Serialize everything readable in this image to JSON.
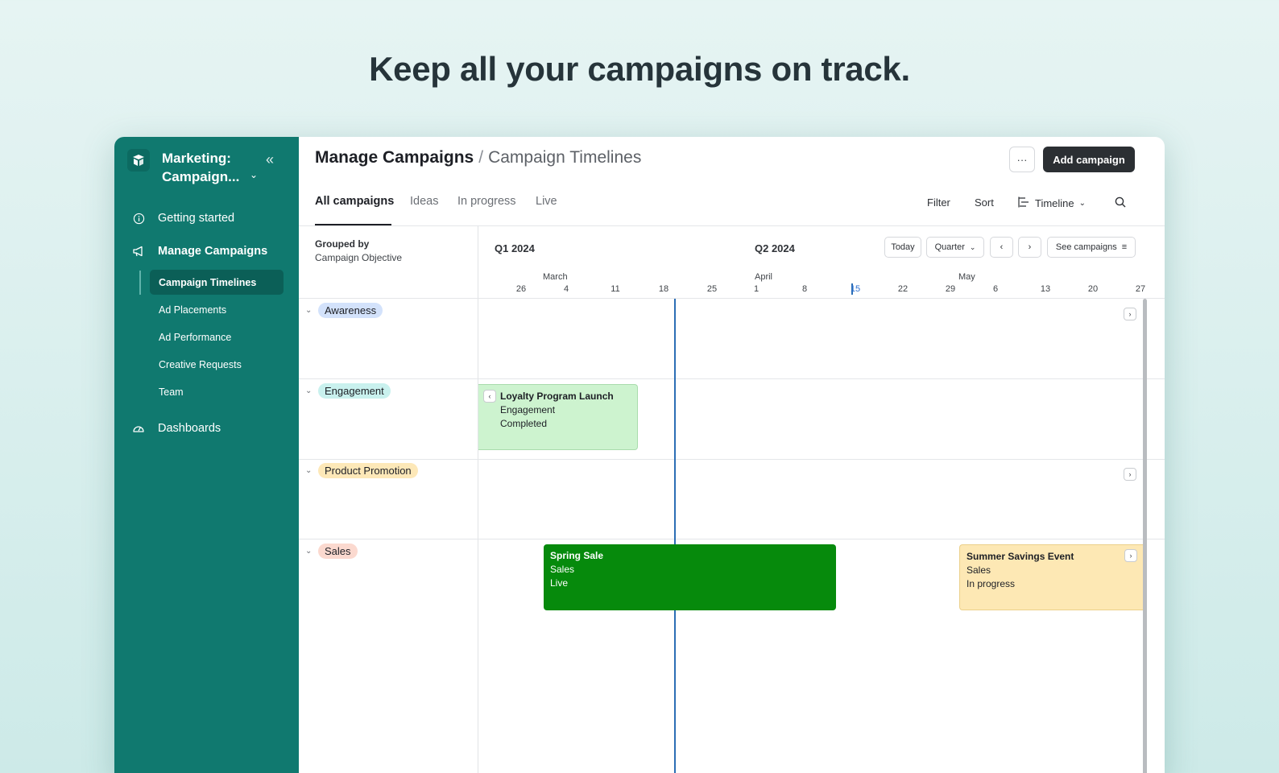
{
  "hero": {
    "title": "Keep all your campaigns on track."
  },
  "sidebar": {
    "workspace": {
      "name_line1": "Marketing:",
      "name_line2": "Campaign..."
    },
    "nav": {
      "getting_started": "Getting started",
      "manage_campaigns": "Manage Campaigns",
      "dashboards": "Dashboards"
    },
    "sub_items": [
      {
        "label": "Campaign Timelines",
        "active": true
      },
      {
        "label": "Ad Placements",
        "active": false
      },
      {
        "label": "Ad Performance",
        "active": false
      },
      {
        "label": "Creative Requests",
        "active": false
      },
      {
        "label": "Team",
        "active": false
      }
    ]
  },
  "header": {
    "breadcrumb_main": "Manage Campaigns",
    "breadcrumb_sep": "/",
    "breadcrumb_sub": "Campaign Timelines",
    "more_label": "···",
    "add_label": "Add campaign"
  },
  "tabs": [
    "All campaigns",
    "Ideas",
    "In progress",
    "Live"
  ],
  "toolbar": {
    "filter": "Filter",
    "sort": "Sort",
    "view": "Timeline"
  },
  "grouping": {
    "label": "Grouped by",
    "value": "Campaign Objective"
  },
  "timeline": {
    "quarters": [
      "Q1 2024",
      "Q2 2024"
    ],
    "today_label": "Today",
    "range_label": "Quarter",
    "see_label": "See campaigns",
    "months": [
      "March",
      "April",
      "May"
    ],
    "days": [
      "26",
      "4",
      "11",
      "18",
      "25",
      "1",
      "8",
      "15",
      "22",
      "29",
      "6",
      "13",
      "20",
      "27"
    ],
    "today_day": "15"
  },
  "groups": [
    {
      "label": "Awareness",
      "color": "#d3e2fb"
    },
    {
      "label": "Engagement",
      "color": "#c9f1ee"
    },
    {
      "label": "Product Promotion",
      "color": "#fde8b8"
    },
    {
      "label": "Sales",
      "color": "#fbd9cf"
    }
  ],
  "campaigns": [
    {
      "title": "Loyalty Program Launch",
      "objective": "Engagement",
      "status": "Completed",
      "color": "#cdf3cf"
    },
    {
      "title": "Spring Sale",
      "objective": "Sales",
      "status": "Live",
      "color": "#068a0c"
    },
    {
      "title": "Summer Savings Event",
      "objective": "Sales",
      "status": "In progress",
      "color": "#fde8b4"
    }
  ]
}
